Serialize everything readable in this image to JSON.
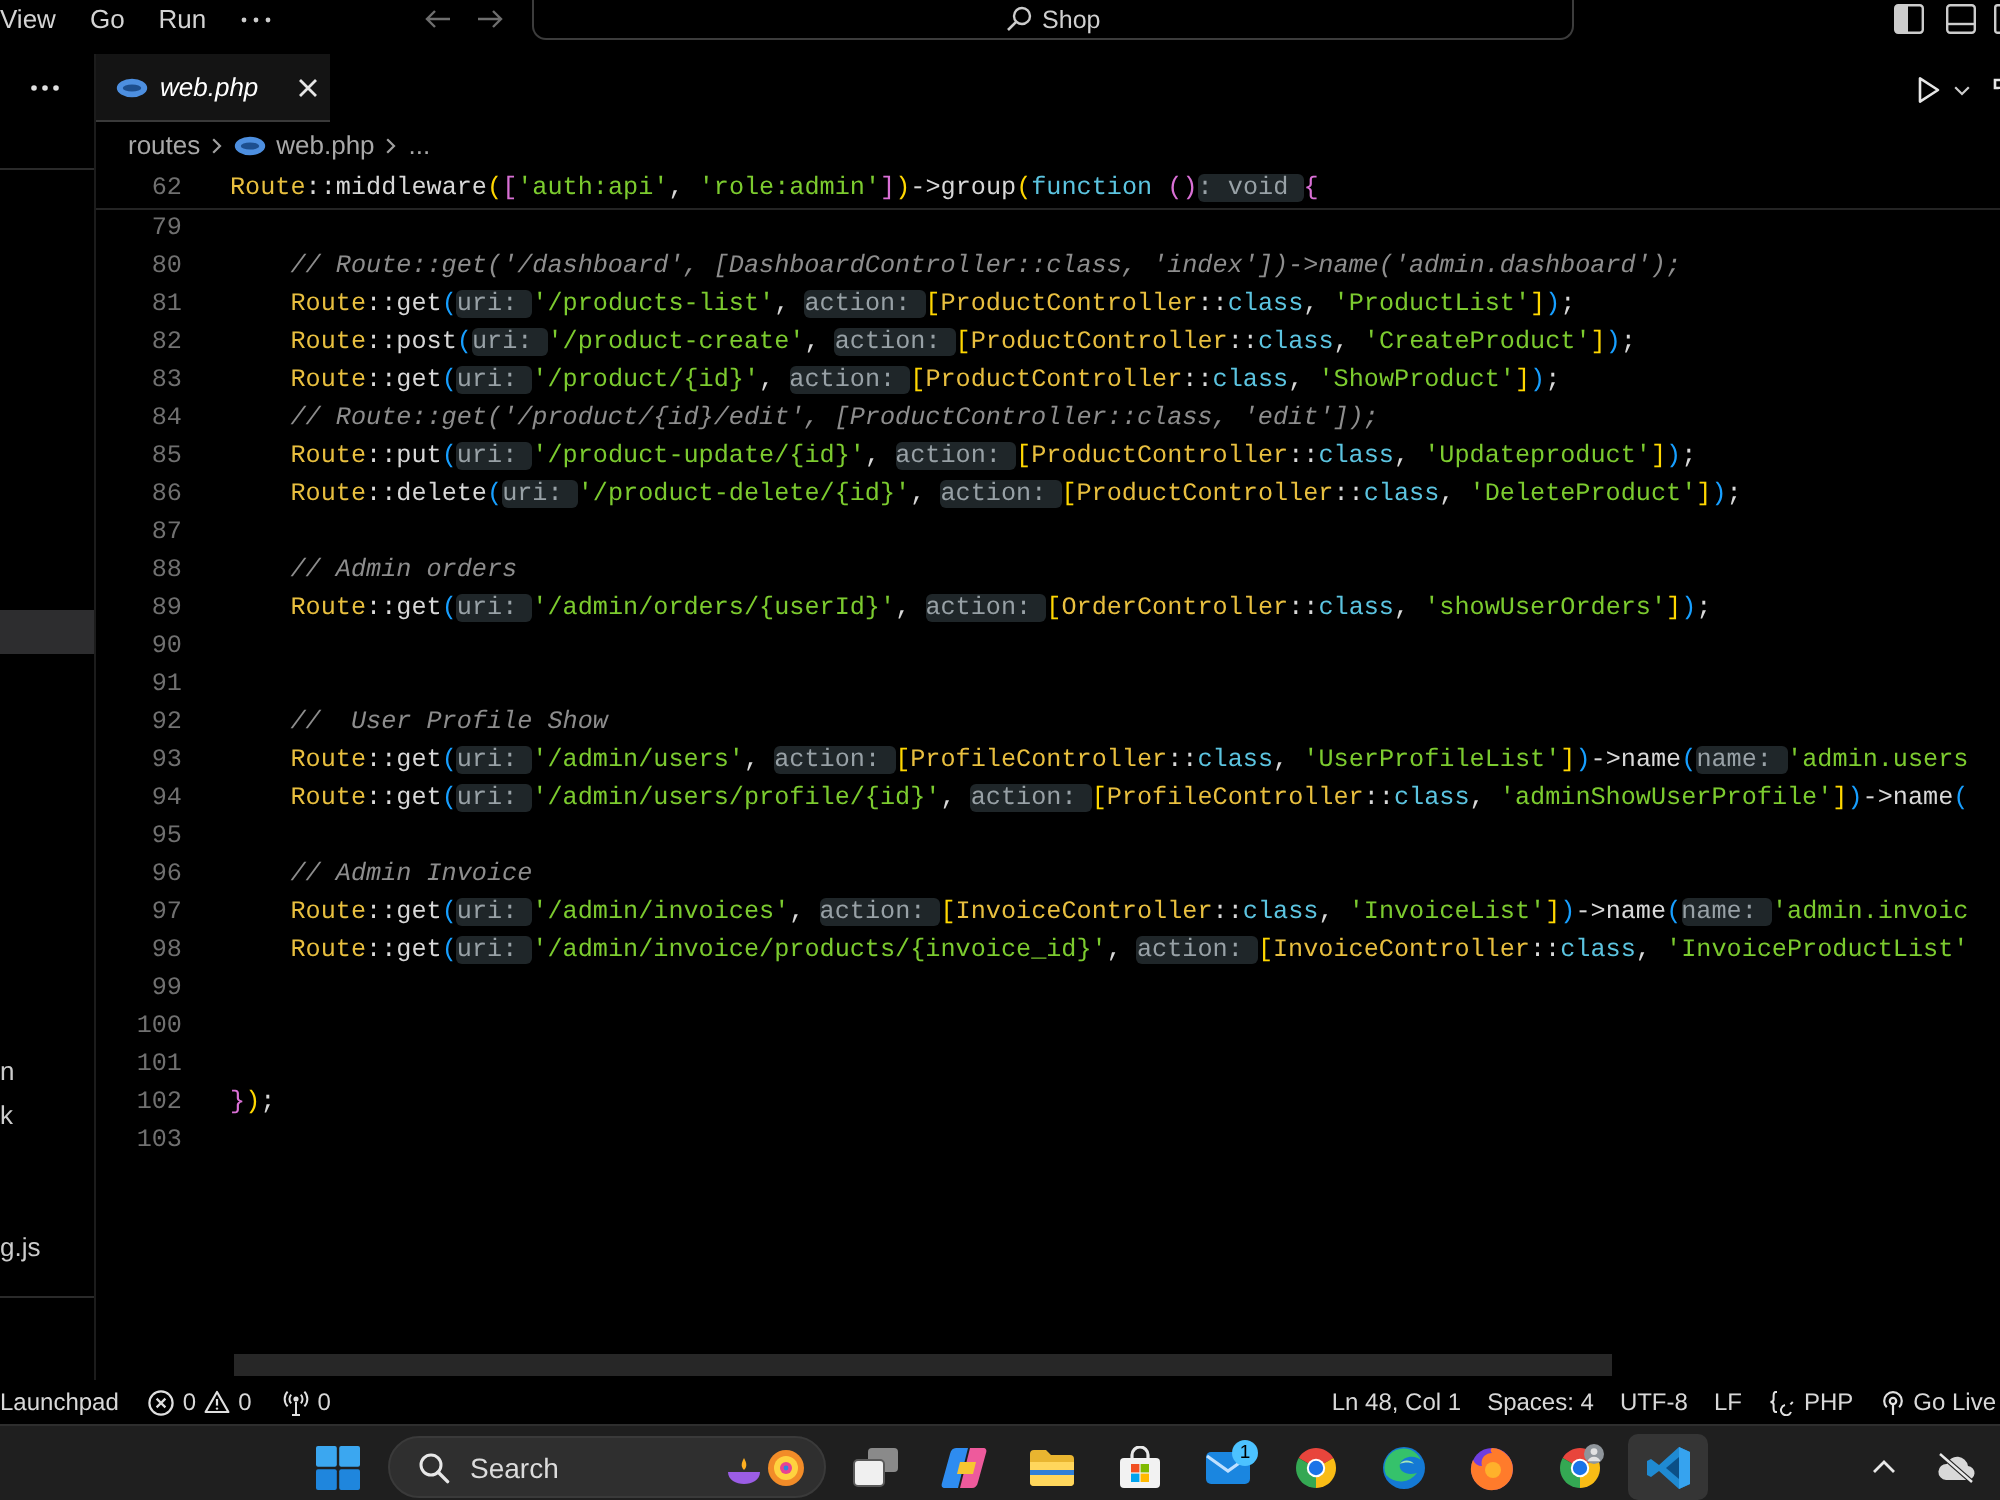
{
  "menu": [
    "View",
    "Go",
    "Run"
  ],
  "command_center": {
    "label": "Shop"
  },
  "sidebar": {
    "items": [
      {
        "selected": true
      },
      {
        "label": "n",
        "selected": false
      },
      {
        "label": "k",
        "selected": false
      },
      {
        "label": "g.js",
        "selected": false
      }
    ]
  },
  "tabs": [
    {
      "label": "web.php",
      "selected": true,
      "preview": true
    }
  ],
  "breadcrumbs": [
    {
      "kind": "folder",
      "label": "routes"
    },
    {
      "kind": "file",
      "label": "web.php"
    },
    {
      "kind": "more",
      "label": "..."
    }
  ],
  "sticky_line": {
    "number": "62",
    "tokens": [
      {
        "kind": "type",
        "text": "Route"
      },
      {
        "kind": "plain",
        "text": "::middleware"
      },
      {
        "kind": "b1",
        "text": "("
      },
      {
        "kind": "b2",
        "text": "["
      },
      {
        "kind": "string",
        "text": "'auth:api'"
      },
      {
        "kind": "plain",
        "text": ", "
      },
      {
        "kind": "string",
        "text": "'role:admin'"
      },
      {
        "kind": "b2",
        "text": "]"
      },
      {
        "kind": "b1",
        "text": ")"
      },
      {
        "kind": "plain",
        "text": "->group"
      },
      {
        "kind": "b1",
        "text": "("
      },
      {
        "kind": "keyword",
        "text": "function "
      },
      {
        "kind": "b2",
        "text": "()"
      },
      {
        "kind": "hint",
        "text": ": void"
      },
      {
        "kind": "b2",
        "text": "{"
      }
    ]
  },
  "code_lines": [
    {
      "number": "79"
    },
    {
      "number": "80",
      "tokens": [
        {
          "kind": "comment",
          "text": "    // Route::get('/dashboard', [DashboardController::class, 'index'])->name('admin.dashboard');"
        }
      ]
    },
    {
      "number": "81",
      "tokens": [
        {
          "kind": "type",
          "text": "    Route"
        },
        {
          "kind": "plain",
          "text": "::get"
        },
        {
          "kind": "b3",
          "text": "("
        },
        {
          "kind": "hint",
          "text": "uri:"
        },
        {
          "kind": "string",
          "text": "'/products-list'"
        },
        {
          "kind": "plain",
          "text": ", "
        },
        {
          "kind": "hint",
          "text": "action:"
        },
        {
          "kind": "b1",
          "text": "["
        },
        {
          "kind": "type",
          "text": "ProductController"
        },
        {
          "kind": "plain",
          "text": "::"
        },
        {
          "kind": "keyword",
          "text": "class"
        },
        {
          "kind": "plain",
          "text": ", "
        },
        {
          "kind": "string",
          "text": "'ProductList'"
        },
        {
          "kind": "b1",
          "text": "]"
        },
        {
          "kind": "b3",
          "text": ")"
        },
        {
          "kind": "plain",
          "text": ";"
        }
      ]
    },
    {
      "number": "82",
      "tokens": [
        {
          "kind": "type",
          "text": "    Route"
        },
        {
          "kind": "plain",
          "text": "::post"
        },
        {
          "kind": "b3",
          "text": "("
        },
        {
          "kind": "hint",
          "text": "uri:"
        },
        {
          "kind": "string",
          "text": "'/product-create'"
        },
        {
          "kind": "plain",
          "text": ", "
        },
        {
          "kind": "hint",
          "text": "action:"
        },
        {
          "kind": "b1",
          "text": "["
        },
        {
          "kind": "type",
          "text": "ProductController"
        },
        {
          "kind": "plain",
          "text": "::"
        },
        {
          "kind": "keyword",
          "text": "class"
        },
        {
          "kind": "plain",
          "text": ", "
        },
        {
          "kind": "string",
          "text": "'CreateProduct'"
        },
        {
          "kind": "b1",
          "text": "]"
        },
        {
          "kind": "b3",
          "text": ")"
        },
        {
          "kind": "plain",
          "text": ";"
        }
      ]
    },
    {
      "number": "83",
      "tokens": [
        {
          "kind": "type",
          "text": "    Route"
        },
        {
          "kind": "plain",
          "text": "::get"
        },
        {
          "kind": "b3",
          "text": "("
        },
        {
          "kind": "hint",
          "text": "uri:"
        },
        {
          "kind": "string",
          "text": "'/product/{id}'"
        },
        {
          "kind": "plain",
          "text": ", "
        },
        {
          "kind": "hint",
          "text": "action:"
        },
        {
          "kind": "b1",
          "text": "["
        },
        {
          "kind": "type",
          "text": "ProductController"
        },
        {
          "kind": "plain",
          "text": "::"
        },
        {
          "kind": "keyword",
          "text": "class"
        },
        {
          "kind": "plain",
          "text": ", "
        },
        {
          "kind": "string",
          "text": "'ShowProduct'"
        },
        {
          "kind": "b1",
          "text": "]"
        },
        {
          "kind": "b3",
          "text": ")"
        },
        {
          "kind": "plain",
          "text": ";"
        }
      ]
    },
    {
      "number": "84",
      "tokens": [
        {
          "kind": "comment",
          "text": "    // Route::get('/product/{id}/edit', [ProductController::class, 'edit']);"
        }
      ]
    },
    {
      "number": "85",
      "tokens": [
        {
          "kind": "type",
          "text": "    Route"
        },
        {
          "kind": "plain",
          "text": "::put"
        },
        {
          "kind": "b3",
          "text": "("
        },
        {
          "kind": "hint",
          "text": "uri:"
        },
        {
          "kind": "string",
          "text": "'/product-update/{id}'"
        },
        {
          "kind": "plain",
          "text": ", "
        },
        {
          "kind": "hint",
          "text": "action:"
        },
        {
          "kind": "b1",
          "text": "["
        },
        {
          "kind": "type",
          "text": "ProductController"
        },
        {
          "kind": "plain",
          "text": "::"
        },
        {
          "kind": "keyword",
          "text": "class"
        },
        {
          "kind": "plain",
          "text": ", "
        },
        {
          "kind": "string",
          "text": "'Updateproduct'"
        },
        {
          "kind": "b1",
          "text": "]"
        },
        {
          "kind": "b3",
          "text": ")"
        },
        {
          "kind": "plain",
          "text": ";"
        }
      ]
    },
    {
      "number": "86",
      "tokens": [
        {
          "kind": "type",
          "text": "    Route"
        },
        {
          "kind": "plain",
          "text": "::delete"
        },
        {
          "kind": "b3",
          "text": "("
        },
        {
          "kind": "hint",
          "text": "uri:"
        },
        {
          "kind": "string",
          "text": "'/product-delete/{id}'"
        },
        {
          "kind": "plain",
          "text": ", "
        },
        {
          "kind": "hint",
          "text": "action:"
        },
        {
          "kind": "b1",
          "text": "["
        },
        {
          "kind": "type",
          "text": "ProductController"
        },
        {
          "kind": "plain",
          "text": "::"
        },
        {
          "kind": "keyword",
          "text": "class"
        },
        {
          "kind": "plain",
          "text": ", "
        },
        {
          "kind": "string",
          "text": "'DeleteProduct'"
        },
        {
          "kind": "b1",
          "text": "]"
        },
        {
          "kind": "b3",
          "text": ")"
        },
        {
          "kind": "plain",
          "text": ";"
        }
      ]
    },
    {
      "number": "87"
    },
    {
      "number": "88",
      "tokens": [
        {
          "kind": "comment",
          "text": "    // Admin orders"
        }
      ]
    },
    {
      "number": "89",
      "tokens": [
        {
          "kind": "type",
          "text": "    Route"
        },
        {
          "kind": "plain",
          "text": "::get"
        },
        {
          "kind": "b3",
          "text": "("
        },
        {
          "kind": "hint",
          "text": "uri:"
        },
        {
          "kind": "string",
          "text": "'/admin/orders/{userId}'"
        },
        {
          "kind": "plain",
          "text": ", "
        },
        {
          "kind": "hint",
          "text": "action:"
        },
        {
          "kind": "b1",
          "text": "["
        },
        {
          "kind": "type",
          "text": "OrderController"
        },
        {
          "kind": "plain",
          "text": "::"
        },
        {
          "kind": "keyword",
          "text": "class"
        },
        {
          "kind": "plain",
          "text": ", "
        },
        {
          "kind": "string",
          "text": "'showUserOrders'"
        },
        {
          "kind": "b1",
          "text": "]"
        },
        {
          "kind": "b3",
          "text": ")"
        },
        {
          "kind": "plain",
          "text": ";"
        }
      ]
    },
    {
      "number": "90"
    },
    {
      "number": "91"
    },
    {
      "number": "92",
      "tokens": [
        {
          "kind": "comment",
          "text": "    //  User Profile Show"
        }
      ]
    },
    {
      "number": "93",
      "tokens": [
        {
          "kind": "type",
          "text": "    Route"
        },
        {
          "kind": "plain",
          "text": "::get"
        },
        {
          "kind": "b3",
          "text": "("
        },
        {
          "kind": "hint",
          "text": "uri:"
        },
        {
          "kind": "string",
          "text": "'/admin/users'"
        },
        {
          "kind": "plain",
          "text": ", "
        },
        {
          "kind": "hint",
          "text": "action:"
        },
        {
          "kind": "b1",
          "text": "["
        },
        {
          "kind": "type",
          "text": "ProfileController"
        },
        {
          "kind": "plain",
          "text": "::"
        },
        {
          "kind": "keyword",
          "text": "class"
        },
        {
          "kind": "plain",
          "text": ", "
        },
        {
          "kind": "string",
          "text": "'UserProfileList'"
        },
        {
          "kind": "b1",
          "text": "]"
        },
        {
          "kind": "b3",
          "text": ")"
        },
        {
          "kind": "plain",
          "text": "->name"
        },
        {
          "kind": "b3",
          "text": "("
        },
        {
          "kind": "hint",
          "text": "name:"
        },
        {
          "kind": "string",
          "text": "'admin.users"
        }
      ]
    },
    {
      "number": "94",
      "tokens": [
        {
          "kind": "type",
          "text": "    Route"
        },
        {
          "kind": "plain",
          "text": "::get"
        },
        {
          "kind": "b3",
          "text": "("
        },
        {
          "kind": "hint",
          "text": "uri:"
        },
        {
          "kind": "string",
          "text": "'/admin/users/profile/{id}'"
        },
        {
          "kind": "plain",
          "text": ", "
        },
        {
          "kind": "hint",
          "text": "action:"
        },
        {
          "kind": "b1",
          "text": "["
        },
        {
          "kind": "type",
          "text": "ProfileController"
        },
        {
          "kind": "plain",
          "text": "::"
        },
        {
          "kind": "keyword",
          "text": "class"
        },
        {
          "kind": "plain",
          "text": ", "
        },
        {
          "kind": "string",
          "text": "'adminShowUserProfile'"
        },
        {
          "kind": "b1",
          "text": "]"
        },
        {
          "kind": "b3",
          "text": ")"
        },
        {
          "kind": "plain",
          "text": "->name"
        },
        {
          "kind": "b3",
          "text": "("
        }
      ]
    },
    {
      "number": "95"
    },
    {
      "number": "96",
      "tokens": [
        {
          "kind": "comment",
          "text": "    // Admin Invoice"
        }
      ]
    },
    {
      "number": "97",
      "tokens": [
        {
          "kind": "type",
          "text": "    Route"
        },
        {
          "kind": "plain",
          "text": "::get"
        },
        {
          "kind": "b3",
          "text": "("
        },
        {
          "kind": "hint",
          "text": "uri:"
        },
        {
          "kind": "string",
          "text": "'/admin/invoices'"
        },
        {
          "kind": "plain",
          "text": ", "
        },
        {
          "kind": "hint",
          "text": "action:"
        },
        {
          "kind": "b1",
          "text": "["
        },
        {
          "kind": "type",
          "text": "InvoiceController"
        },
        {
          "kind": "plain",
          "text": "::"
        },
        {
          "kind": "keyword",
          "text": "class"
        },
        {
          "kind": "plain",
          "text": ", "
        },
        {
          "kind": "string",
          "text": "'InvoiceList'"
        },
        {
          "kind": "b1",
          "text": "]"
        },
        {
          "kind": "b3",
          "text": ")"
        },
        {
          "kind": "plain",
          "text": "->name"
        },
        {
          "kind": "b3",
          "text": "("
        },
        {
          "kind": "hint",
          "text": "name:"
        },
        {
          "kind": "string",
          "text": "'admin.invoic"
        }
      ]
    },
    {
      "number": "98",
      "tokens": [
        {
          "kind": "type",
          "text": "    Route"
        },
        {
          "kind": "plain",
          "text": "::get"
        },
        {
          "kind": "b3",
          "text": "("
        },
        {
          "kind": "hint",
          "text": "uri:"
        },
        {
          "kind": "string",
          "text": "'/admin/invoice/products/{invoice_id}'"
        },
        {
          "kind": "plain",
          "text": ", "
        },
        {
          "kind": "hint",
          "text": "action:"
        },
        {
          "kind": "b1",
          "text": "["
        },
        {
          "kind": "type",
          "text": "InvoiceController"
        },
        {
          "kind": "plain",
          "text": "::"
        },
        {
          "kind": "keyword",
          "text": "class"
        },
        {
          "kind": "plain",
          "text": ", "
        },
        {
          "kind": "string",
          "text": "'InvoiceProductList'"
        }
      ]
    },
    {
      "number": "99"
    },
    {
      "number": "100"
    },
    {
      "number": "101"
    },
    {
      "number": "102",
      "tokens": [
        {
          "kind": "b2",
          "text": "}"
        },
        {
          "kind": "b1",
          "text": ")"
        },
        {
          "kind": "plain",
          "text": ";"
        }
      ]
    },
    {
      "number": "103"
    }
  ],
  "status_bar": {
    "left": [
      {
        "kind": "text",
        "label": "Launchpad"
      },
      {
        "kind": "problems",
        "errors": "0",
        "warnings": "0"
      },
      {
        "kind": "ports",
        "label": "0"
      }
    ],
    "right": [
      {
        "kind": "text",
        "label": "Ln 48, Col 1"
      },
      {
        "kind": "text",
        "label": "Spaces: 4"
      },
      {
        "kind": "text",
        "label": "UTF-8"
      },
      {
        "kind": "text",
        "label": "LF"
      },
      {
        "kind": "language",
        "label": "PHP"
      },
      {
        "kind": "live",
        "label": "Go Live"
      }
    ]
  },
  "taskbar": {
    "search": {
      "placeholder": "Search"
    },
    "apps": [
      {
        "kind": "taskview",
        "selected": false
      },
      {
        "kind": "assistant",
        "selected": false
      },
      {
        "kind": "folder",
        "selected": false
      },
      {
        "kind": "store",
        "selected": false
      },
      {
        "kind": "mail",
        "selected": false,
        "badge": "1"
      },
      {
        "kind": "chrome",
        "selected": false
      },
      {
        "kind": "edge",
        "selected": false
      },
      {
        "kind": "firefox",
        "selected": false
      },
      {
        "kind": "profile",
        "selected": false
      },
      {
        "kind": "editor",
        "selected": true
      }
    ]
  }
}
